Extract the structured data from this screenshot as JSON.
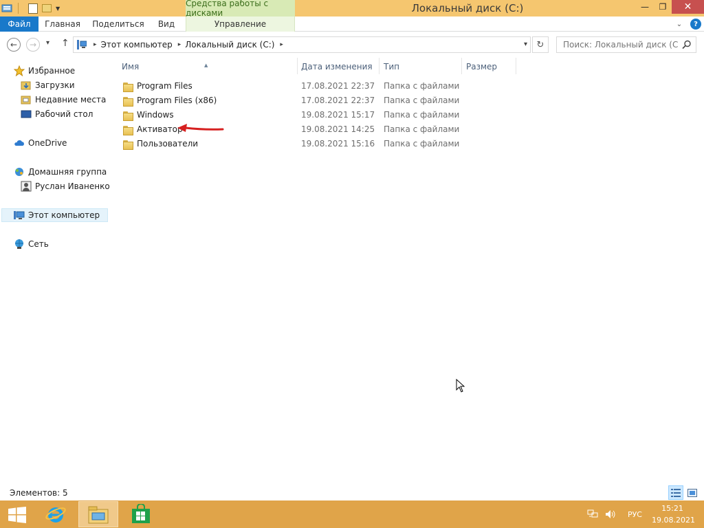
{
  "window": {
    "title": "Локальный диск (C:)",
    "contextual_group": "Средства работы с дисками",
    "minimize": "—",
    "maximize": "❐",
    "close": "✕",
    "accent": "#f5c66f"
  },
  "ribbon": {
    "tabs": [
      {
        "label": "Файл"
      },
      {
        "label": "Главная"
      },
      {
        "label": "Поделиться"
      },
      {
        "label": "Вид"
      },
      {
        "label": "Управление"
      }
    ],
    "expand": "⌄",
    "help": "?"
  },
  "nav": {
    "back": "←",
    "forward": "→",
    "recent": "▾",
    "up": "↑",
    "breadcrumb": [
      "Этот компьютер",
      "Локальный диск (C:)"
    ],
    "refresh": "↻",
    "search_placeholder": "Поиск: Локальный диск (C:)"
  },
  "navpane": {
    "favorites": "Избранное",
    "downloads": "Загрузки",
    "recent_places": "Недавние места",
    "desktop": "Рабочий стол",
    "onedrive": "OneDrive",
    "homegroup": "Домашняя группа",
    "user": "Руслан Иваненко",
    "this_pc": "Этот компьютер",
    "network": "Сеть"
  },
  "columns": {
    "name": "Имя",
    "date": "Дата изменения",
    "type": "Тип",
    "size": "Размер"
  },
  "files": [
    {
      "name": "Program Files",
      "date": "17.08.2021 22:37",
      "type": "Папка с файлами",
      "size": ""
    },
    {
      "name": "Program Files (x86)",
      "date": "17.08.2021 22:37",
      "type": "Папка с файлами",
      "size": ""
    },
    {
      "name": "Windows",
      "date": "19.08.2021 15:17",
      "type": "Папка с файлами",
      "size": ""
    },
    {
      "name": "Активатор",
      "date": "19.08.2021 14:25",
      "type": "Папка с файлами",
      "size": ""
    },
    {
      "name": "Пользователи",
      "date": "19.08.2021 15:16",
      "type": "Папка с файлами",
      "size": ""
    }
  ],
  "status": {
    "items": "Элементов: 5"
  },
  "taskbar": {
    "lang": "РУС",
    "time": "15:21",
    "date": "19.08.2021",
    "color": "#e0a449"
  }
}
